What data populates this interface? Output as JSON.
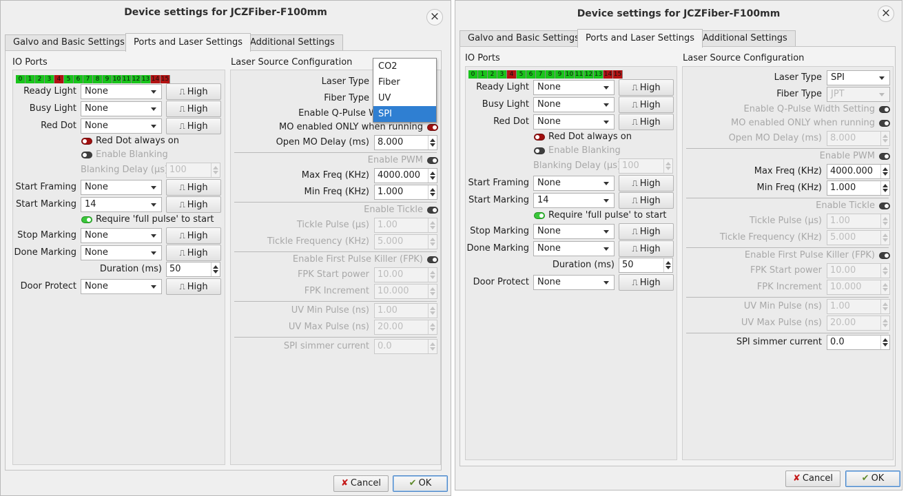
{
  "dialog": {
    "title": "Device settings for JCZFiber-F100mm",
    "close_glyph": "×",
    "tabs": [
      "Galvo and Basic Settings",
      "Ports and Laser Settings",
      "Additional Settings"
    ],
    "active_tab": "Ports and Laser Settings",
    "cancel_label": "Cancel",
    "ok_label": "OK"
  },
  "io": {
    "title": "IO Ports",
    "pins": [
      "0",
      "1",
      "2",
      "3",
      "4",
      "5",
      "6",
      "7",
      "8",
      "9",
      "10",
      "11",
      "12",
      "13",
      "14",
      "15"
    ],
    "pin_states": [
      "on",
      "on",
      "on",
      "on",
      "off",
      "on",
      "on",
      "on",
      "on",
      "on",
      "on",
      "on",
      "on",
      "on",
      "off",
      "off"
    ],
    "colors": {
      "on": "#19c41b",
      "off": "#b21212"
    },
    "pulse_glyph": "⎍",
    "high_label": "High",
    "ready_light": {
      "label": "Ready Light",
      "value": "None"
    },
    "busy_light": {
      "label": "Busy Light",
      "value": "None"
    },
    "red_dot": {
      "label": "Red Dot",
      "value": "None"
    },
    "red_dot_always_on": "Red Dot always on",
    "enable_blanking": "Enable Blanking",
    "blanking_delay": {
      "label": "Blanking Delay (µs)",
      "value": "100"
    },
    "start_framing": {
      "label": "Start Framing",
      "value": "None"
    },
    "start_marking": {
      "label": "Start Marking",
      "value": "14"
    },
    "require_full_pulse": "Require 'full pulse' to start",
    "stop_marking": {
      "label": "Stop Marking",
      "value": "None"
    },
    "done_marking": {
      "label": "Done Marking",
      "value": "None"
    },
    "duration": {
      "label": "Duration (ms)",
      "value": "50"
    },
    "door_protect": {
      "label": "Door Protect",
      "value": "None"
    }
  },
  "laser": {
    "title": "Laser Source Configuration",
    "laser_type": {
      "label": "Laser Type",
      "value": "SPI"
    },
    "fiber_type": {
      "label": "Fiber Type",
      "value": "JPT"
    },
    "laser_type_options": [
      "CO2",
      "Fiber",
      "UV",
      "SPI"
    ],
    "laser_type_selected": "SPI",
    "enable_qpulse": "Enable Q-Pulse Width Setting",
    "enable_qpulse_clipped": "Enable Q-Pulse W",
    "mo_enabled": "MO enabled ONLY when running",
    "open_mo_delay": {
      "label": "Open MO Delay (ms)",
      "value": "8.000"
    },
    "enable_pwm": "Enable PWM",
    "max_freq": {
      "label": "Max Freq (KHz)",
      "value": "4000.000"
    },
    "min_freq": {
      "label": "Min Freq (KHz)",
      "value": "1.000"
    },
    "enable_tickle": "Enable Tickle",
    "tickle_pulse": {
      "label": "Tickle Pulse (µs)",
      "value": "1.00"
    },
    "tickle_freq": {
      "label": "Tickle Frequency (KHz)",
      "value": "5.000"
    },
    "enable_fpk": "Enable First Pulse Killer (FPK)",
    "fpk_start": {
      "label": "FPK Start power",
      "value": "10.00"
    },
    "fpk_increment": {
      "label": "FPK Increment",
      "value": "10.000"
    },
    "uv_min": {
      "label": "UV Min Pulse (ns)",
      "value": "1.00"
    },
    "uv_max": {
      "label": "UV Max Pulse (ns)",
      "value": "20.00"
    },
    "spi_simmer": {
      "label": "SPI simmer current",
      "value": "0.0"
    }
  }
}
